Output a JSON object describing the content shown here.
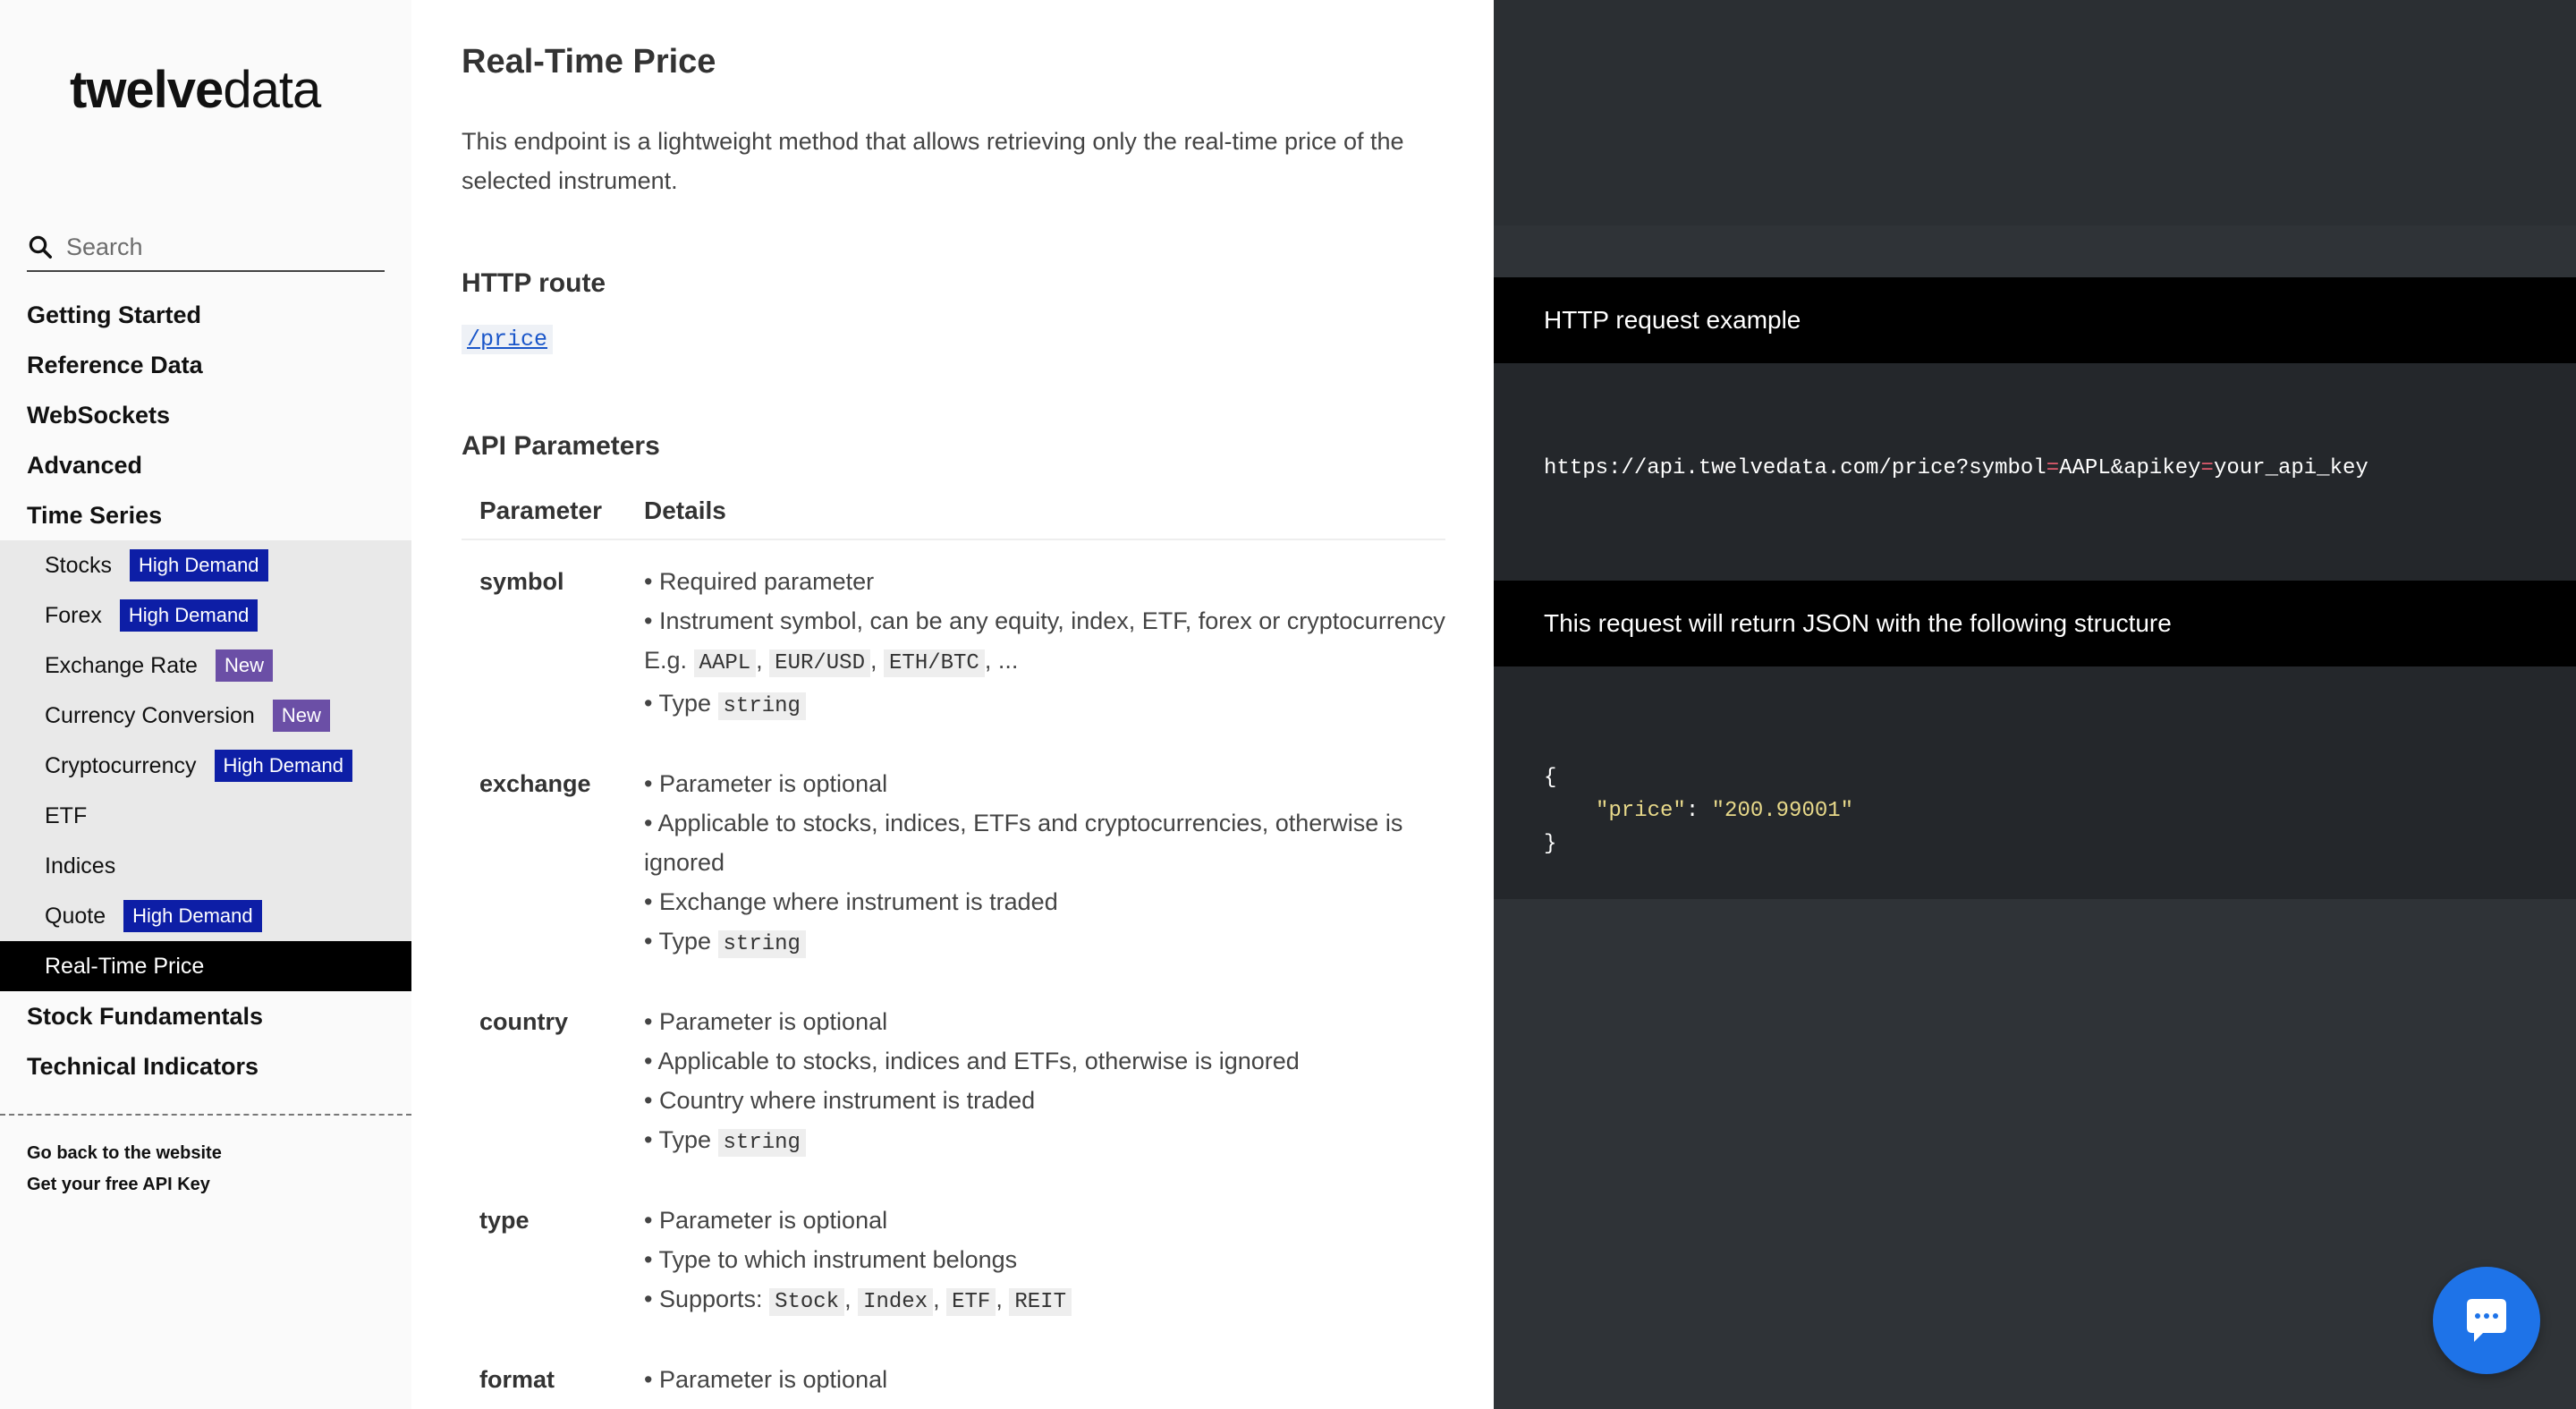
{
  "logo": {
    "part1": "twelve",
    "part2": "data"
  },
  "search": {
    "placeholder": "Search"
  },
  "nav": {
    "items_top": [
      "Getting Started",
      "Reference Data",
      "WebSockets",
      "Advanced",
      "Time Series"
    ],
    "time_series_sub": [
      {
        "label": "Stocks",
        "badge": "High Demand"
      },
      {
        "label": "Forex",
        "badge": "High Demand"
      },
      {
        "label": "Exchange Rate",
        "badge": "New"
      },
      {
        "label": "Currency Conversion",
        "badge": "New"
      },
      {
        "label": "Cryptocurrency",
        "badge": "High Demand"
      },
      {
        "label": "ETF"
      },
      {
        "label": "Indices"
      },
      {
        "label": "Quote",
        "badge": "High Demand"
      },
      {
        "label": "Real-Time Price",
        "active": true
      }
    ],
    "items_bottom": [
      "Stock Fundamentals",
      "Technical Indicators"
    ],
    "footer_links": [
      "Go back to the website",
      "Get your free API Key"
    ]
  },
  "main": {
    "title": "Real-Time Price",
    "intro": "This endpoint is a lightweight method that allows retrieving only the real-time price of the selected instrument.",
    "http_route_title": "HTTP route",
    "route": "/price",
    "api_params_title": "API Parameters",
    "table_headers": [
      "Parameter",
      "Details"
    ],
    "params": {
      "symbol": {
        "name": "symbol",
        "l1": "Required parameter",
        "l2": "Instrument symbol, can be any equity, index, ETF, forex or cryptocurrency",
        "eg": "E.g.",
        "ex1": "AAPL",
        "ex2": "EUR/USD",
        "ex3": "ETH/BTC",
        "ellipsis": ", ...",
        "type_label": "Type",
        "type": "string"
      },
      "exchange": {
        "name": "exchange",
        "l1": "Parameter is optional",
        "l2": "Applicable to stocks, indices, ETFs and cryptocurrencies, otherwise is ignored",
        "l3": "Exchange where instrument is traded",
        "type_label": "Type",
        "type": "string"
      },
      "country": {
        "name": "country",
        "l1": "Parameter is optional",
        "l2": "Applicable to stocks, indices and ETFs, otherwise is ignored",
        "l3": "Country where instrument is traded",
        "type_label": "Type",
        "type": "string"
      },
      "type": {
        "name": "type",
        "l1": "Parameter is optional",
        "l2": "Type to which instrument belongs",
        "supports": "Supports:",
        "s1": "Stock",
        "s2": "Index",
        "s3": "ETF",
        "s4": "REIT"
      },
      "format": {
        "name": "format",
        "l1": "Parameter is optional"
      }
    }
  },
  "right": {
    "request_title": "HTTP request example",
    "url_base": "https://api.twelvedata.com/price?symbol",
    "eq": "=",
    "url_mid": "AAPL&apikey",
    "url_end": "your_api_key",
    "response_title": "This request will return JSON with the following structure",
    "json_open": "{",
    "json_key": "\"price\"",
    "json_colon": ": ",
    "json_value": "\"200.99001\"",
    "json_close": "}"
  },
  "icons": {
    "search": "search-icon",
    "chat": "chat-icon"
  },
  "colors": {
    "high_demand": "#0d1ea6",
    "new": "#6b4fa6",
    "chat": "#1e73e8",
    "link": "#1a56c9"
  }
}
